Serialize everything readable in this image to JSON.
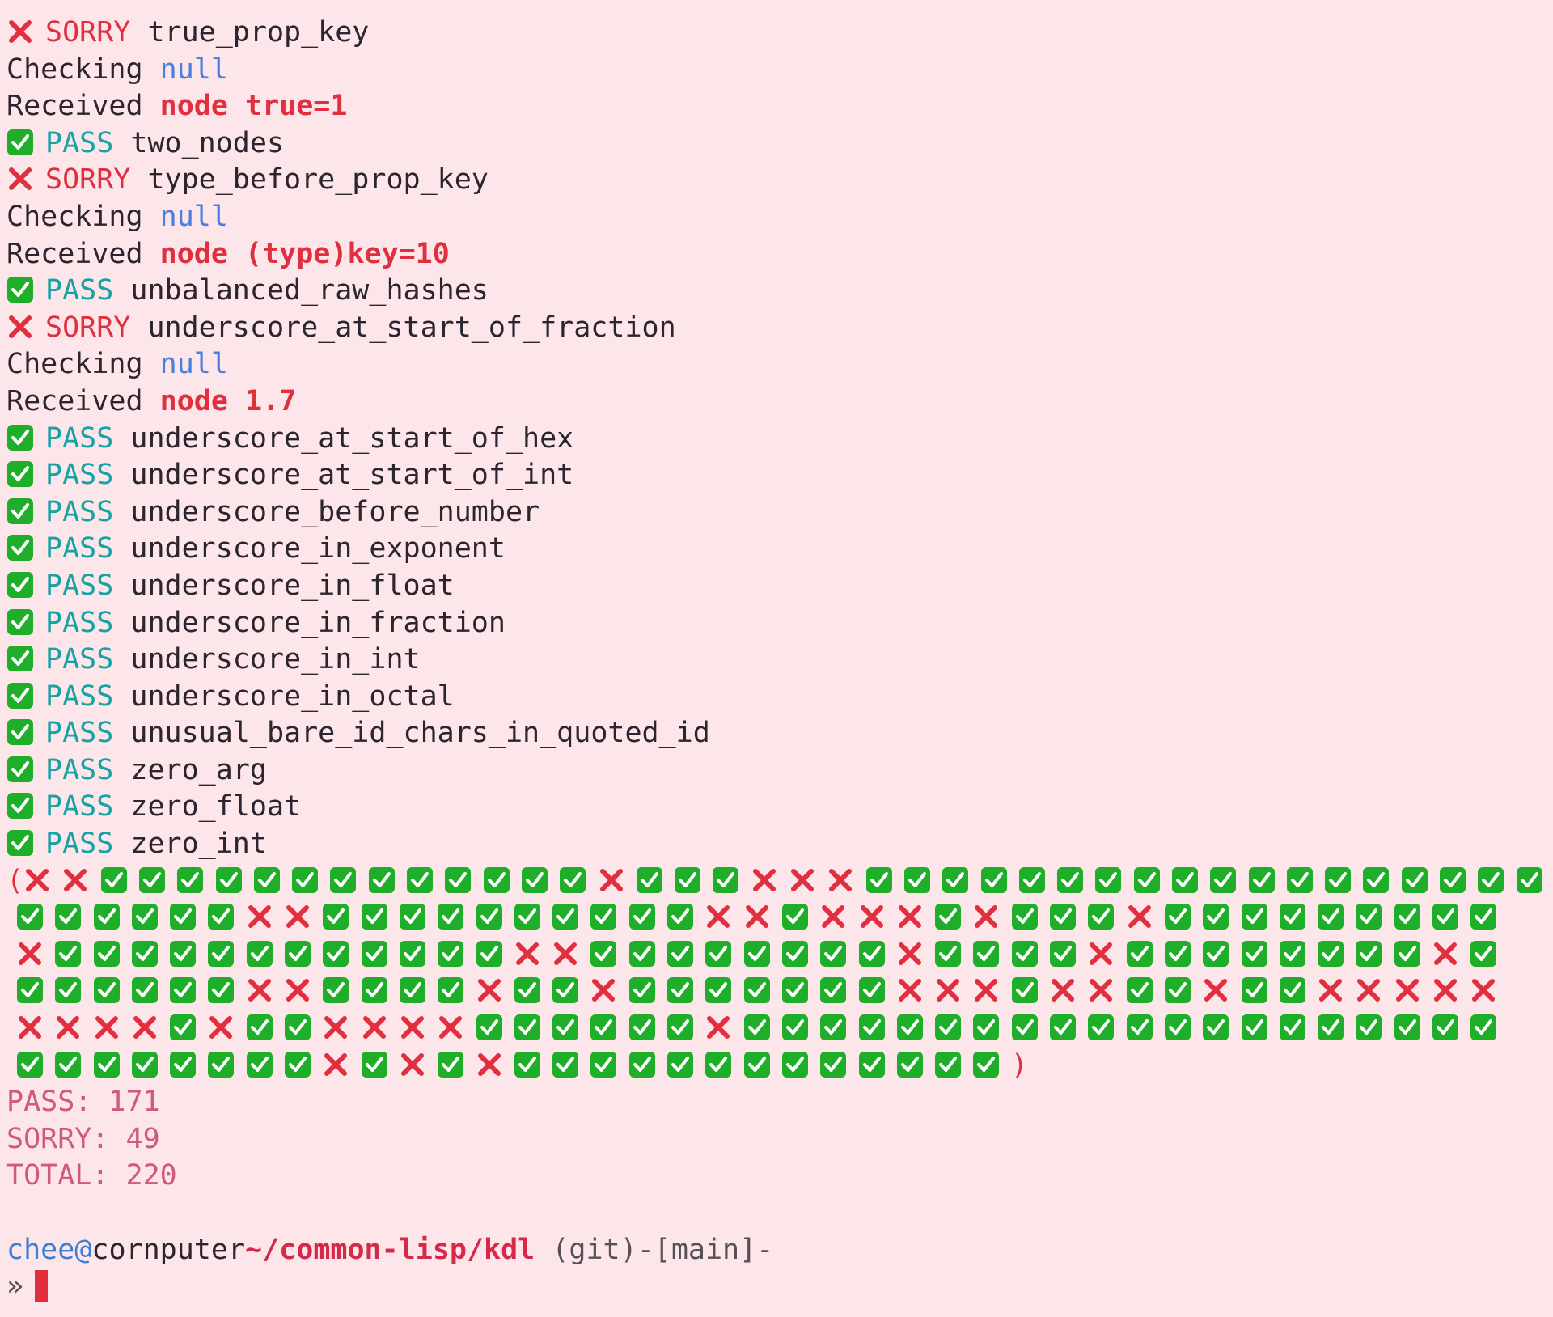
{
  "colors": {
    "background": "#fde6ea",
    "pass": "#17a3a3",
    "sorry": "#e0303f",
    "null_keyword": "#4a7fe0",
    "check_icon": "#1fae2a",
    "cross_icon": "#e0303f",
    "user": "#3e7fd6",
    "path": "#d8284a"
  },
  "log": [
    {
      "kind": "result",
      "status": "sorry",
      "icon": "cross-mark-icon",
      "label": "SORRY",
      "name": "true_prop_key"
    },
    {
      "kind": "checking",
      "prefix": "Checking",
      "value": "null"
    },
    {
      "kind": "received",
      "prefix": "Received",
      "value": "node true=1"
    },
    {
      "kind": "result",
      "status": "pass",
      "icon": "check-mark-icon",
      "label": "PASS",
      "name": "two_nodes"
    },
    {
      "kind": "result",
      "status": "sorry",
      "icon": "cross-mark-icon",
      "label": "SORRY",
      "name": "type_before_prop_key"
    },
    {
      "kind": "checking",
      "prefix": "Checking",
      "value": "null"
    },
    {
      "kind": "received",
      "prefix": "Received",
      "value": "node (type)key=10"
    },
    {
      "kind": "result",
      "status": "pass",
      "icon": "check-mark-icon",
      "label": "PASS",
      "name": "unbalanced_raw_hashes"
    },
    {
      "kind": "result",
      "status": "sorry",
      "icon": "cross-mark-icon",
      "label": "SORRY",
      "name": "underscore_at_start_of_fraction"
    },
    {
      "kind": "checking",
      "prefix": "Checking",
      "value": "null"
    },
    {
      "kind": "received",
      "prefix": "Received",
      "value": "node 1.7"
    },
    {
      "kind": "result",
      "status": "pass",
      "icon": "check-mark-icon",
      "label": "PASS",
      "name": "underscore_at_start_of_hex"
    },
    {
      "kind": "result",
      "status": "pass",
      "icon": "check-mark-icon",
      "label": "PASS",
      "name": "underscore_at_start_of_int"
    },
    {
      "kind": "result",
      "status": "pass",
      "icon": "check-mark-icon",
      "label": "PASS",
      "name": "underscore_before_number"
    },
    {
      "kind": "result",
      "status": "pass",
      "icon": "check-mark-icon",
      "label": "PASS",
      "name": "underscore_in_exponent"
    },
    {
      "kind": "result",
      "status": "pass",
      "icon": "check-mark-icon",
      "label": "PASS",
      "name": "underscore_in_float"
    },
    {
      "kind": "result",
      "status": "pass",
      "icon": "check-mark-icon",
      "label": "PASS",
      "name": "underscore_in_fraction"
    },
    {
      "kind": "result",
      "status": "pass",
      "icon": "check-mark-icon",
      "label": "PASS",
      "name": "underscore_in_int"
    },
    {
      "kind": "result",
      "status": "pass",
      "icon": "check-mark-icon",
      "label": "PASS",
      "name": "underscore_in_octal"
    },
    {
      "kind": "result",
      "status": "pass",
      "icon": "check-mark-icon",
      "label": "PASS",
      "name": "unusual_bare_id_chars_in_quoted_id"
    },
    {
      "kind": "result",
      "status": "pass",
      "icon": "check-mark-icon",
      "label": "PASS",
      "name": "zero_arg"
    },
    {
      "kind": "result",
      "status": "pass",
      "icon": "check-mark-icon",
      "label": "PASS",
      "name": "zero_float"
    },
    {
      "kind": "result",
      "status": "pass",
      "icon": "check-mark-icon",
      "label": "PASS",
      "name": "zero_int"
    }
  ],
  "result_grid": {
    "open_paren": "(",
    "close_paren": ")",
    "rows": [
      "XXPPPPPPPPPPPPPXPPPXXXPPPPPPPPPPPPPPPPPP",
      "PPPPPPXXPPPPPPPPPPXXPXXXPXPPPXPPPPPPPPP",
      "XPPPPPPPPPPPPXXPPPPPPPPXPPPPXPPPPPPPPXP",
      "PPPPPPXXPPPPXPPXPPPPPPPXXXPXXPPXPPXXXXX",
      "XXXXPXPPXXXXPPPPPPXPPPPPPPPPPPPPPPPPPPP",
      "PPPPPPPPXPXPXPPPPPPPPPPPPP"
    ]
  },
  "summary": {
    "pass": "PASS: 171",
    "sorry": "SORRY: 49",
    "total": "TOTAL: 220"
  },
  "prompt": {
    "user": "chee",
    "at": "@",
    "host": "cornputer",
    "path": "~/common-lisp/kdl",
    "git": " (git)-[main]-",
    "arrow": "»"
  }
}
